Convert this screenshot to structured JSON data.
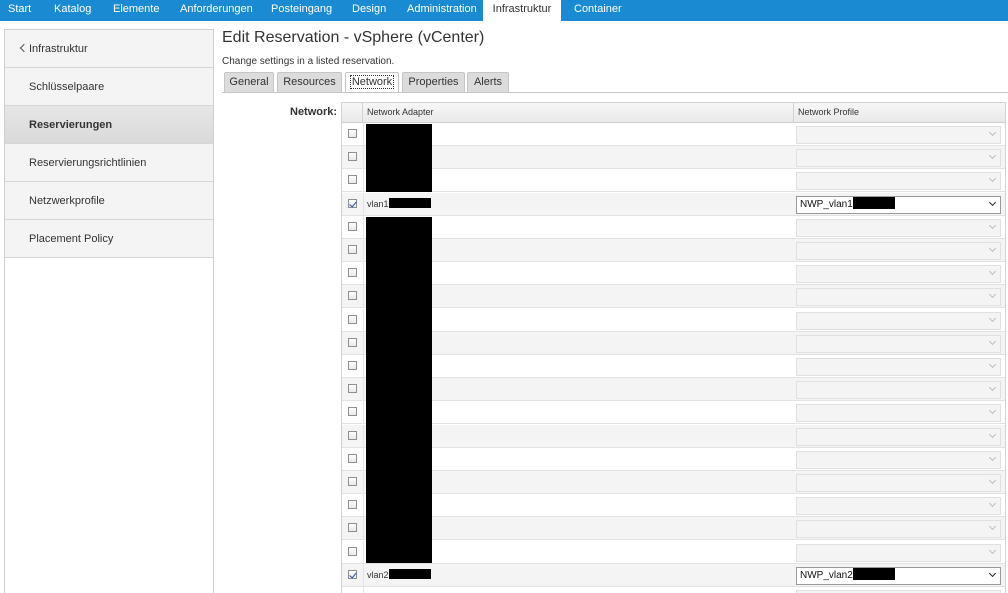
{
  "topnav": {
    "items": [
      "Start",
      "Katalog",
      "Elemente",
      "Anforderungen",
      "Posteingang",
      "Design",
      "Administration",
      "Infrastruktur",
      "Container"
    ],
    "active": "Infrastruktur"
  },
  "sidebar": {
    "back_label": "Infrastruktur",
    "items": [
      "Schlüsselpaare",
      "Reservierungen",
      "Reservierungsrichtlinien",
      "Netzwerkprofile",
      "Placement Policy"
    ],
    "active": "Reservierungen"
  },
  "page": {
    "title": "Edit Reservation - vSphere (vCenter)",
    "subtitle": "Change settings in a listed reservation."
  },
  "tabs": {
    "items": [
      "General",
      "Resources",
      "Network",
      "Properties",
      "Alerts"
    ],
    "active": "Network"
  },
  "network": {
    "label": "Network:",
    "columns": {
      "adapter": "Network Adapter",
      "profile": "Network Profile"
    },
    "rows": [
      {
        "checked": false,
        "adapter": "",
        "profile": ""
      },
      {
        "checked": false,
        "adapter": "",
        "profile": ""
      },
      {
        "checked": false,
        "adapter": "",
        "profile": ""
      },
      {
        "checked": true,
        "adapter": "vlan1",
        "profile": "NWP_vlan1"
      },
      {
        "checked": false,
        "adapter": "",
        "profile": ""
      },
      {
        "checked": false,
        "adapter": "",
        "profile": ""
      },
      {
        "checked": false,
        "adapter": "",
        "profile": ""
      },
      {
        "checked": false,
        "adapter": "",
        "profile": ""
      },
      {
        "checked": false,
        "adapter": "",
        "profile": ""
      },
      {
        "checked": false,
        "adapter": "",
        "profile": ""
      },
      {
        "checked": false,
        "adapter": "",
        "profile": ""
      },
      {
        "checked": false,
        "adapter": "",
        "profile": ""
      },
      {
        "checked": false,
        "adapter": "",
        "profile": ""
      },
      {
        "checked": false,
        "adapter": "",
        "profile": ""
      },
      {
        "checked": false,
        "adapter": "",
        "profile": ""
      },
      {
        "checked": false,
        "adapter": "",
        "profile": ""
      },
      {
        "checked": false,
        "adapter": "",
        "profile": ""
      },
      {
        "checked": false,
        "adapter": "",
        "profile": ""
      },
      {
        "checked": false,
        "adapter": "",
        "profile": ""
      },
      {
        "checked": true,
        "adapter": "vlan2",
        "profile": "NWP_vlan2"
      },
      {
        "checked": false,
        "adapter": "",
        "profile": ""
      }
    ]
  },
  "colors": {
    "nav": "#1a8ad2",
    "redaction": "#000000"
  }
}
